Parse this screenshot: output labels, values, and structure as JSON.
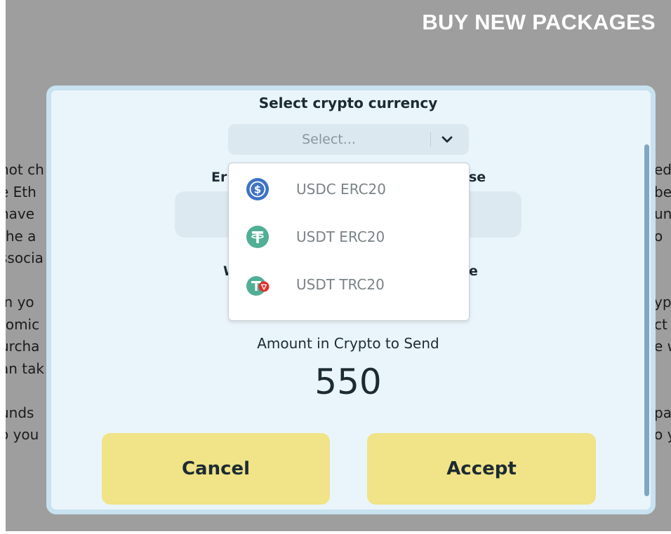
{
  "page": {
    "title": "BUY NEW PACKAGES",
    "background_left_lines": [
      "not ch",
      "e Eth",
      " have",
      " the a",
      "ssocia",
      "",
      " in yo",
      "tomic",
      "urcha",
      "an tak",
      "",
      "unds",
      "o you"
    ],
    "background_right_lines": [
      "ed",
      "be",
      "un",
      "o",
      "",
      "",
      "yp",
      "ct",
      "e w",
      "",
      "",
      "pa",
      "o y"
    ]
  },
  "modal": {
    "heading": "Select crypto currency",
    "select": {
      "placeholder": "Select..."
    },
    "partial_label_1_left": "Er",
    "partial_label_1_right": "se",
    "partial_label_2_left": "W",
    "partial_label_2_right": "e",
    "amount_label": "Amount in Crypto to Send",
    "amount_value": "550",
    "cancel_label": "Cancel",
    "accept_label": "Accept"
  },
  "dropdown": {
    "options": [
      {
        "label": "USDC ERC20",
        "icon": "usdc-icon",
        "color": "#3e73c4"
      },
      {
        "label": "USDT ERC20",
        "icon": "usdt-icon",
        "color": "#50af95"
      },
      {
        "label": "USDT TRC20",
        "icon": "usdt-tron-icon",
        "color": "#50af95",
        "badge_color": "#e0312e"
      }
    ]
  },
  "colors": {
    "backdrop": "#9e9e9e",
    "modal_bg": "#eaf5fb",
    "button_bg": "#f1e387",
    "text_dark": "#1c2b33"
  }
}
